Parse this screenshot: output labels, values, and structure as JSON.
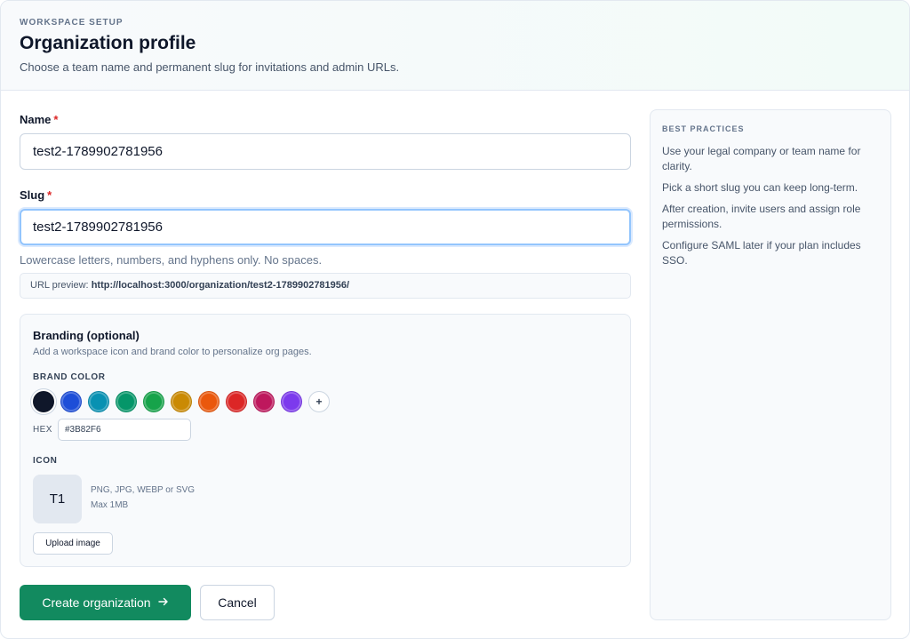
{
  "header": {
    "eyebrow": "WORKSPACE SETUP",
    "title": "Organization profile",
    "subtitle": "Choose a team name and permanent slug for invitations and admin URLs."
  },
  "form": {
    "name": {
      "label": "Name",
      "required_mark": "*",
      "value": "test2-1789902781956"
    },
    "slug": {
      "label": "Slug",
      "required_mark": "*",
      "value": "test2-1789902781956",
      "hint": "Lowercase letters, numbers, and hyphens only. No spaces."
    },
    "url_preview": {
      "label": "URL preview:",
      "url": "http://localhost:3000/organization/test2-1789902781956/"
    }
  },
  "branding": {
    "title": "Branding (optional)",
    "description": "Add a workspace icon and brand color to personalize org pages.",
    "brand_color_label": "BRAND COLOR",
    "swatches": [
      "#0f172a",
      "#1d4ed8",
      "#0891b2",
      "#059669",
      "#16a34a",
      "#ca8a04",
      "#ea580c",
      "#dc2626",
      "#be185d",
      "#7c3aed"
    ],
    "add_swatch_label": "+",
    "hex_label": "HEX",
    "hex_value": "#3B82F6",
    "icon_label": "ICON",
    "icon_initials": "T1",
    "icon_formats": "PNG, JPG, WEBP or SVG",
    "icon_max_size": "Max 1MB",
    "upload_label": "Upload image"
  },
  "actions": {
    "create_label": "Create organization",
    "create_icon": "arrow-right-icon",
    "cancel_label": "Cancel"
  },
  "sidebar": {
    "title": "BEST PRACTICES",
    "tips": [
      "Use your legal company or team name for clarity.",
      "Pick a short slug you can keep long-term.",
      "After creation, invite users and assign role permissions.",
      "Configure SAML later if your plan includes SSO."
    ]
  },
  "colors": {
    "primary": "#128a5f",
    "required": "#dc2626",
    "focus_ring": "#93c5fd"
  }
}
